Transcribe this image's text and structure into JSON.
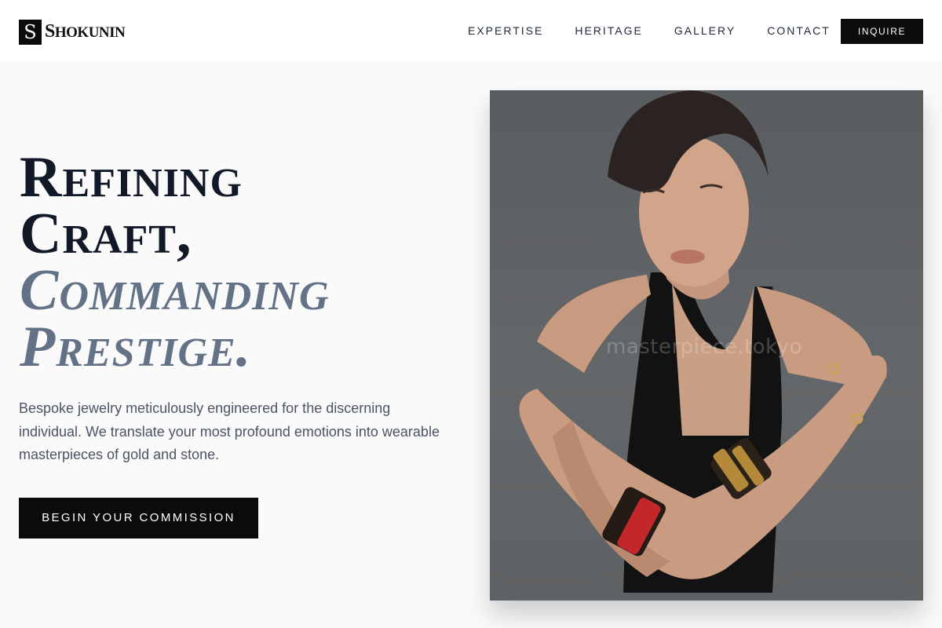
{
  "brand": {
    "mark": "S",
    "name_initial": "S",
    "name_rest": "HOKUNIN"
  },
  "nav": [
    {
      "label": "EXPERTISE"
    },
    {
      "label": "HERITAGE"
    },
    {
      "label": "GALLERY"
    },
    {
      "label": "CONTACT"
    }
  ],
  "header": {
    "inquire_label": "INQUIRE"
  },
  "hero": {
    "title_line1": "Refining",
    "title_line2": "Craft,",
    "title_line3": "Commanding",
    "title_line4": "Prestige.",
    "description": "Bespoke jewelry meticulously engineered for the discerning individual. We translate your most profound emotions into wearable masterpieces of gold and stone.",
    "cta_label": "BEGIN YOUR COMMISSION"
  },
  "image": {
    "watermark": "masterpiece.tokyo"
  },
  "colors": {
    "primary": "#0b0b0b",
    "accent": "#647287",
    "background": "#fafafa",
    "text_muted": "#4b5563"
  }
}
